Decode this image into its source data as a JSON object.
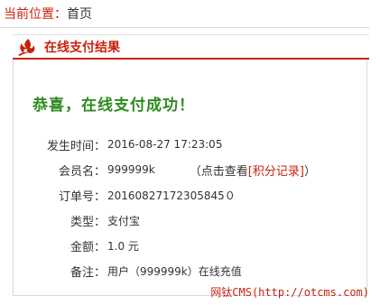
{
  "breadcrumb": {
    "label": "当前位置：",
    "home": "首页"
  },
  "panel": {
    "title": "在线支付结果"
  },
  "result": {
    "message": "恭喜，在线支付成功！"
  },
  "details": {
    "time": {
      "label": "发生时间：",
      "value": "2016-08-27 17:23:05"
    },
    "member": {
      "label": "会员名：",
      "value": "999999k",
      "paren_open": "（点击查看",
      "points_link": "[积分记录]",
      "paren_close": "）"
    },
    "order": {
      "label": "订单号：",
      "value": "20160827172305845０"
    },
    "type": {
      "label": "类型：",
      "value": "支付宝"
    },
    "amount": {
      "label": "金额：",
      "value": "1.0 元"
    },
    "note": {
      "label": "备注：",
      "value": "用户（999999k）在线充值"
    }
  },
  "watermark": "网钛CMS(http://otcms.com)",
  "colors": {
    "accent": "#c8220f",
    "success": "#2f8a21"
  }
}
